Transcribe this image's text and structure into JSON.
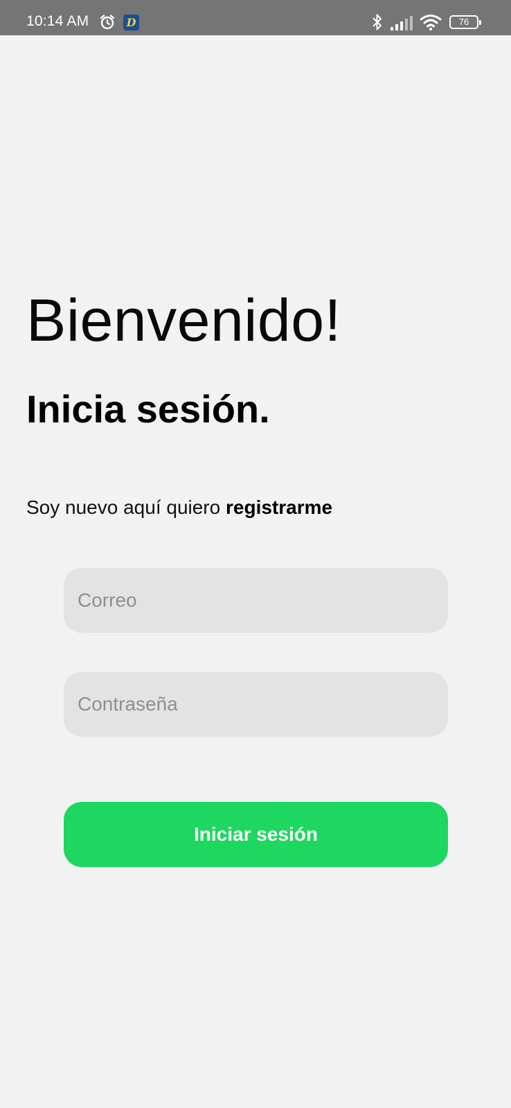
{
  "status_bar": {
    "time": "10:14 AM",
    "alarm_icon": "alarm-icon",
    "app_icon": "D",
    "battery_level": "76",
    "icons": [
      "bluetooth-icon",
      "signal-icon",
      "wifi-icon",
      "battery-icon"
    ]
  },
  "login": {
    "welcome": "Bienvenido!",
    "subtitle": "Inicia sesión.",
    "register_prefix": "Soy nuevo aquí quiero",
    "register_link": "registrarme",
    "email_placeholder": "Correo",
    "password_placeholder": "Contraseña",
    "submit_label": "Iniciar sesión"
  },
  "colors": {
    "background": "#f2f2f2",
    "status_bar": "#757575",
    "input_background": "#e3e3e3",
    "accent": "#1ed760"
  }
}
